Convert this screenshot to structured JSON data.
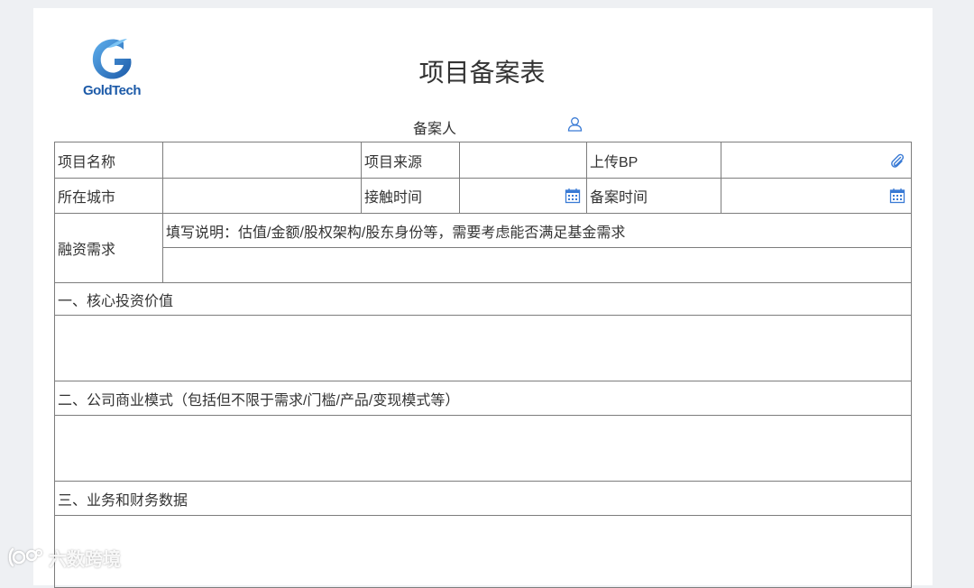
{
  "logo": {
    "text": "GoldTech",
    "colors": {
      "primary": "#1c5aa8",
      "light": "#3c8fd8"
    }
  },
  "title": "项目备案表",
  "filer": {
    "label": "备案人",
    "icon": "user-icon"
  },
  "form": {
    "project_name_label": "项目名称",
    "project_source_label": "项目来源",
    "upload_bp_label": "上传BP",
    "city_label": "所在城市",
    "contact_time_label": "接触时间",
    "filing_time_label": "备案时间",
    "financing_label": "融资需求",
    "financing_hint": "填写说明：估值/金额/股权架构/股东身份等，需要考虑能否满足基金需求",
    "section1": "一、核心投资价值",
    "section2": "二、公司商业模式（包括但不限于需求/门槛/产品/变现模式等）",
    "section3": "三、业务和财务数据"
  },
  "icons": {
    "attach": "paperclip-icon",
    "calendar": "calendar-icon",
    "accent": "#3a7bd5"
  },
  "watermark": {
    "text": "六数跨境"
  }
}
